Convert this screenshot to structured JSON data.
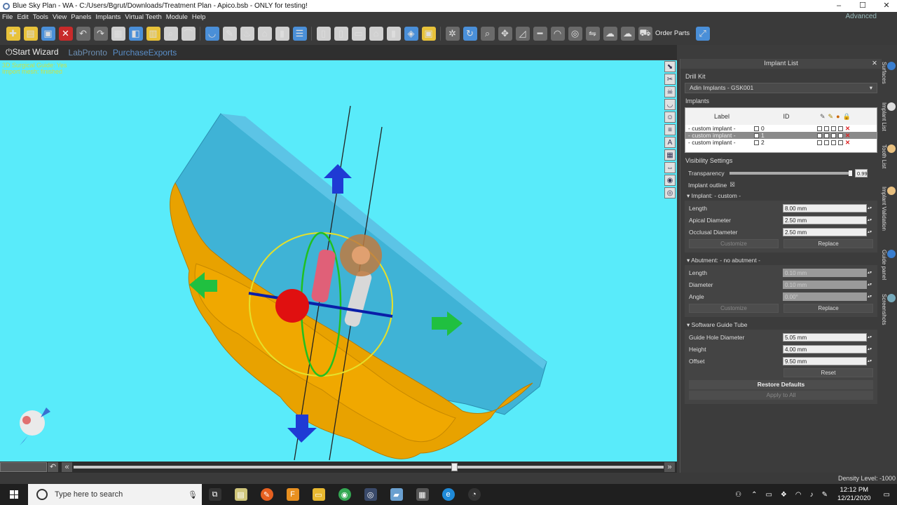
{
  "window": {
    "title": "Blue Sky Plan - WA - C:/Users/Bgrut/Downloads/Treatment Plan - Apico.bsb - ONLY for testing!",
    "min": "–",
    "max": "☐",
    "close": "✕"
  },
  "menu": {
    "items": [
      "File",
      "Edit",
      "Tools",
      "View",
      "Panels",
      "Implants",
      "Virtual Teeth",
      "Module",
      "Help"
    ],
    "advanced": "Advanced"
  },
  "toolbar": {
    "order_parts": "Order Parts"
  },
  "wizard": {
    "start": "Start Wizard",
    "labpronto": "LabPronto",
    "purchase": "Purchase",
    "exports": "Exports"
  },
  "viewport": {
    "info_line1": "3D Surgical Guide: Yes",
    "info_line2": "Import mesh: finished"
  },
  "panel": {
    "title": "Implant List",
    "drill_kit_label": "Drill Kit",
    "drill_kit_value": "Adin Implants - GSK001",
    "implants_label": "Implants",
    "table": {
      "col_label": "Label",
      "col_id": "ID",
      "rows": [
        {
          "label": "- custom implant -",
          "id": "0"
        },
        {
          "label": "- custom implant -",
          "id": "1"
        },
        {
          "label": "- custom implant -",
          "id": "2"
        }
      ]
    },
    "visibility_label": "Visibility Settings",
    "transparency_label": "Transparency",
    "transparency_value": "0.99",
    "implant_outline_label": "Implant outline",
    "implant_group": "Implant: - custom -",
    "length_label": "Length",
    "length_value": "8.00 mm",
    "apical_label": "Apical Diameter",
    "apical_value": "2.50 mm",
    "occlusal_label": "Occlusal Diameter",
    "occlusal_value": "2.50 mm",
    "customize_label": "Customize",
    "replace_label": "Replace",
    "abutment_group": "Abutment: - no abutment -",
    "ab_length_label": "Length",
    "ab_length_value": "0.10 mm",
    "ab_diameter_label": "Diameter",
    "ab_diameter_value": "0.10 mm",
    "ab_angle_label": "Angle",
    "ab_angle_value": "0.00°",
    "guide_group": "Software Guide Tube",
    "hole_label": "Guide Hole Diameter",
    "hole_value": "5.05 mm",
    "height_label": "Height",
    "height_value": "4.00 mm",
    "offset_label": "Offset",
    "offset_value": "9.50 mm",
    "reset_label": "Reset",
    "restore_label": "Restore Defaults",
    "apply_label": "Apply to All"
  },
  "side_tabs": [
    "Surfaces",
    "Implant List",
    "Tooth List",
    "Implant Validation",
    "Guide panel",
    "Screenshots"
  ],
  "status": {
    "density": "Density Level: -1000"
  },
  "taskbar": {
    "search_placeholder": "Type here to search",
    "time": "12:12 PM",
    "date": "12/21/2020"
  }
}
